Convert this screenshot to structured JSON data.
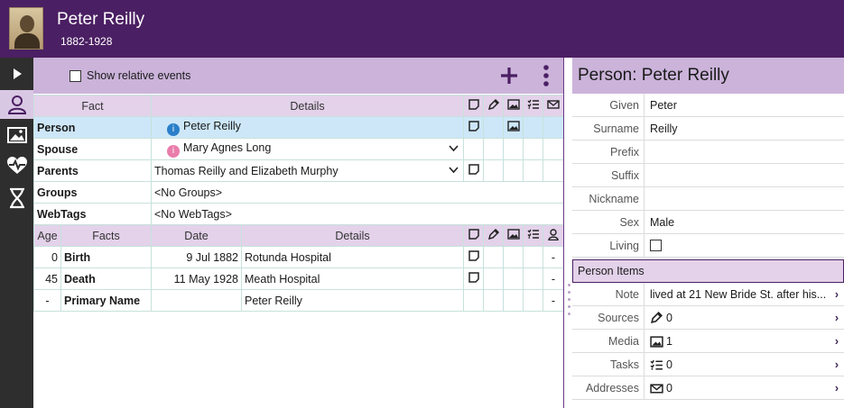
{
  "header": {
    "name": "Peter Reilly",
    "dates": "1882-1928"
  },
  "toolbar": {
    "show_relative_events": "Show relative events"
  },
  "facts_table": {
    "headers": {
      "fact": "Fact",
      "details": "Details"
    },
    "rows": [
      {
        "fact": "Person",
        "details": "Peter Reilly"
      },
      {
        "fact": "Spouse",
        "details": "Mary Agnes Long"
      },
      {
        "fact": "Parents",
        "details": "Thomas Reilly and Elizabeth Murphy"
      },
      {
        "fact": "Groups",
        "details": "<No Groups>"
      },
      {
        "fact": "WebTags",
        "details": "<No WebTags>"
      }
    ]
  },
  "events_table": {
    "headers": {
      "age": "Age",
      "facts": "Facts",
      "date": "Date",
      "details": "Details"
    },
    "rows": [
      {
        "age": "0",
        "fact": "Birth",
        "date": "9 Jul 1882",
        "details": "Rotunda Hospital",
        "last": "-"
      },
      {
        "age": "45",
        "fact": "Death",
        "date": "11 May 1928",
        "details": "Meath Hospital",
        "last": "-"
      },
      {
        "age": "-",
        "fact": "Primary Name",
        "date": "",
        "details": "Peter Reilly",
        "last": "-"
      }
    ]
  },
  "person_panel": {
    "title": "Person: Peter Reilly",
    "fields": {
      "given": {
        "label": "Given",
        "value": "Peter"
      },
      "surname": {
        "label": "Surname",
        "value": "Reilly"
      },
      "prefix": {
        "label": "Prefix",
        "value": ""
      },
      "suffix": {
        "label": "Suffix",
        "value": ""
      },
      "nickname": {
        "label": "Nickname",
        "value": ""
      },
      "sex": {
        "label": "Sex",
        "value": "Male"
      },
      "living": {
        "label": "Living"
      }
    },
    "items_header": "Person Items",
    "items": {
      "note": {
        "label": "Note",
        "value": "lived at 21 New Bride St. after his..."
      },
      "sources": {
        "label": "Sources",
        "value": "0"
      },
      "media": {
        "label": "Media",
        "value": "1"
      },
      "tasks": {
        "label": "Tasks",
        "value": "0"
      },
      "addresses": {
        "label": "Addresses",
        "value": "0"
      }
    }
  },
  "colors": {
    "header_bg": "#4b1f63",
    "toolbar_bg": "#cbb3da",
    "table_header_bg": "#e3d2ea",
    "selected_row": "#cde7f8",
    "male": "#2a7fc9",
    "female": "#e97dab"
  }
}
